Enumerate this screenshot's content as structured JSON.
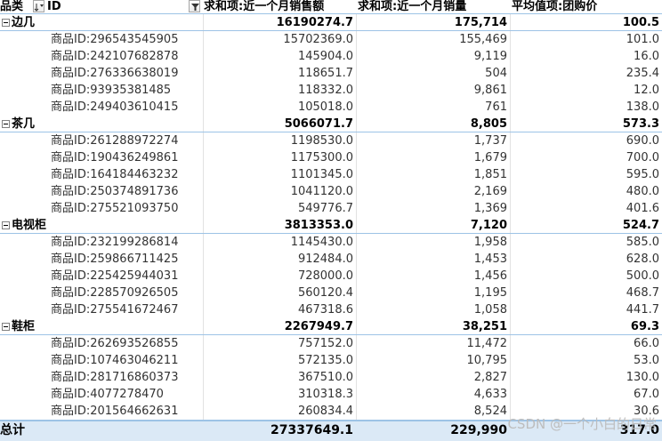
{
  "header": {
    "category": "品类",
    "id": "ID",
    "sales_amount": "求和项:近一个月销售额",
    "sales_volume": "求和项:近一个月销量",
    "group_price": "平均值项:团购价"
  },
  "groups": [
    {
      "name": "边几",
      "sales_amount": "16190274.7",
      "sales_volume": "175,714",
      "group_price": "100.5",
      "items": [
        {
          "id": "商品ID:296543545905",
          "sales_amount": "15702369.0",
          "sales_volume": "155,469",
          "group_price": "101.0"
        },
        {
          "id": "商品ID:242107682878",
          "sales_amount": "145904.0",
          "sales_volume": "9,119",
          "group_price": "16.0"
        },
        {
          "id": "商品ID:276336638019",
          "sales_amount": "118651.7",
          "sales_volume": "504",
          "group_price": "235.4"
        },
        {
          "id": "商品ID:93935381485",
          "sales_amount": "118332.0",
          "sales_volume": "9,861",
          "group_price": "12.0"
        },
        {
          "id": "商品ID:249403610415",
          "sales_amount": "105018.0",
          "sales_volume": "761",
          "group_price": "138.0"
        }
      ]
    },
    {
      "name": "茶几",
      "sales_amount": "5066071.7",
      "sales_volume": "8,805",
      "group_price": "573.3",
      "items": [
        {
          "id": "商品ID:261288972274",
          "sales_amount": "1198530.0",
          "sales_volume": "1,737",
          "group_price": "690.0"
        },
        {
          "id": "商品ID:190436249861",
          "sales_amount": "1175300.0",
          "sales_volume": "1,679",
          "group_price": "700.0"
        },
        {
          "id": "商品ID:164184463232",
          "sales_amount": "1101345.0",
          "sales_volume": "1,851",
          "group_price": "595.0"
        },
        {
          "id": "商品ID:250374891736",
          "sales_amount": "1041120.0",
          "sales_volume": "2,169",
          "group_price": "480.0"
        },
        {
          "id": "商品ID:275521093750",
          "sales_amount": "549776.7",
          "sales_volume": "1,369",
          "group_price": "401.6"
        }
      ]
    },
    {
      "name": "电视柜",
      "sales_amount": "3813353.0",
      "sales_volume": "7,120",
      "group_price": "524.7",
      "items": [
        {
          "id": "商品ID:232199286814",
          "sales_amount": "1145430.0",
          "sales_volume": "1,958",
          "group_price": "585.0"
        },
        {
          "id": "商品ID:259866711425",
          "sales_amount": "912484.0",
          "sales_volume": "1,453",
          "group_price": "628.0"
        },
        {
          "id": "商品ID:225425944031",
          "sales_amount": "728000.0",
          "sales_volume": "1,456",
          "group_price": "500.0"
        },
        {
          "id": "商品ID:228570926505",
          "sales_amount": "560120.4",
          "sales_volume": "1,195",
          "group_price": "468.7"
        },
        {
          "id": "商品ID:275541672467",
          "sales_amount": "467318.6",
          "sales_volume": "1,058",
          "group_price": "441.7"
        }
      ]
    },
    {
      "name": "鞋柜",
      "sales_amount": "2267949.7",
      "sales_volume": "38,251",
      "group_price": "69.3",
      "items": [
        {
          "id": "商品ID:262693526855",
          "sales_amount": "757152.0",
          "sales_volume": "11,472",
          "group_price": "66.0"
        },
        {
          "id": "商品ID:107463046211",
          "sales_amount": "572135.0",
          "sales_volume": "10,795",
          "group_price": "53.0"
        },
        {
          "id": "商品ID:281716860373",
          "sales_amount": "367510.0",
          "sales_volume": "2,827",
          "group_price": "130.0"
        },
        {
          "id": "商品ID:4077278470",
          "sales_amount": "310318.3",
          "sales_volume": "4,633",
          "group_price": "67.0"
        },
        {
          "id": "商品ID:201564662631",
          "sales_amount": "260834.4",
          "sales_volume": "8,524",
          "group_price": "30.6"
        }
      ]
    }
  ],
  "total": {
    "label": "总计",
    "sales_amount": "27337649.1",
    "sales_volume": "229,990",
    "group_price": "317.0"
  },
  "watermark": "CSDN @一个小白的日常",
  "icons": {
    "filter": "filter-dropdown-icon",
    "sort": "sort-ascending-icon",
    "collapse": "collapse-minus-icon"
  },
  "colors": {
    "header_border": "#9dc3e6",
    "total_background": "#dbe9f6"
  }
}
